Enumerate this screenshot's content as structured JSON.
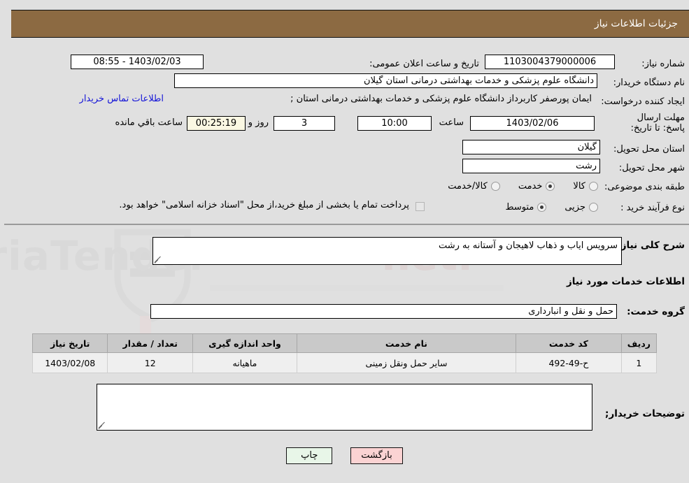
{
  "header": {
    "title": "جزئیات اطلاعات نیاز",
    "bg_color": "#8c6a42",
    "text_color": "#ffffff"
  },
  "page": {
    "background_color": "#e0e0e0",
    "watermark_text": "AriaTender.net"
  },
  "info": {
    "need_number_label": "شماره نیاز:",
    "need_number_value": "1103004379000006",
    "announce_label": "تاریخ و ساعت اعلان عمومی:",
    "announce_value": "1403/02/03 - 08:55",
    "buyer_org_label": "نام دستگاه خریدار:",
    "buyer_org_value": "دانشگاه علوم پزشکی و خدمات بهداشتی  درمانی استان گیلان",
    "creator_label": "ایجاد کننده درخواست:",
    "creator_value": "ایمان پورصفر کاربرداز دانشگاه علوم پزشکی و خدمات بهداشتی  درمانی استان ;",
    "creator_link": "اطلاعات تماس خریدار",
    "deadline_label": "مهلت ارسال پاسخ: تا تاریخ:",
    "deadline_date": "1403/02/06",
    "deadline_time_label": "ساعت",
    "deadline_time": "10:00",
    "days_value": "3",
    "days_label": "روز و",
    "countdown_value": "00:25:19",
    "countdown_label": "ساعت باقي مانده",
    "province_label": "استان محل تحویل:",
    "province_value": "گیلان",
    "city_label": "شهر محل تحویل:",
    "city_value": "رشت",
    "category_label": "طبقه بندی موضوعی:",
    "category_options": [
      {
        "label": "کالا",
        "selected": false
      },
      {
        "label": "خدمت",
        "selected": true
      },
      {
        "label": "کالا/خدمت",
        "selected": false
      }
    ],
    "process_label": "نوع فرآیند خرید :",
    "process_options": [
      {
        "label": "جزیی",
        "selected": false
      },
      {
        "label": "متوسط",
        "selected": true
      }
    ],
    "treasury_checkbox_checked": false,
    "treasury_note": "پرداخت تمام یا بخشی از مبلغ خرید،از محل \"اسناد خزانه اسلامی\" خواهد بود."
  },
  "description": {
    "summary_label": "شرح کلی نیاز:",
    "summary_value": "سرویس ایاب و ذهاب لاهیجان و آستانه به رشت",
    "services_heading": "اطلاعات خدمات مورد نیاز",
    "service_group_label": "گروه خدمت:",
    "service_group_value": "حمل و نقل و انبارداری",
    "buyer_notes_label": "توضیحات خریدار;",
    "buyer_notes_value": ""
  },
  "table": {
    "columns": [
      "ردیف",
      "کد خدمت",
      "نام خدمت",
      "واحد اندازه گیری",
      "تعداد / مقدار",
      "تاریخ نیاز"
    ],
    "rows": [
      {
        "index": "1",
        "code": "ح-49-492",
        "name": "سایر حمل ونقل زمینی",
        "unit": "ماهیانه",
        "quantity": "12",
        "need_date": "1403/02/08"
      }
    ]
  },
  "footer": {
    "print_label": "چاپ",
    "back_label": "بازگشت"
  }
}
